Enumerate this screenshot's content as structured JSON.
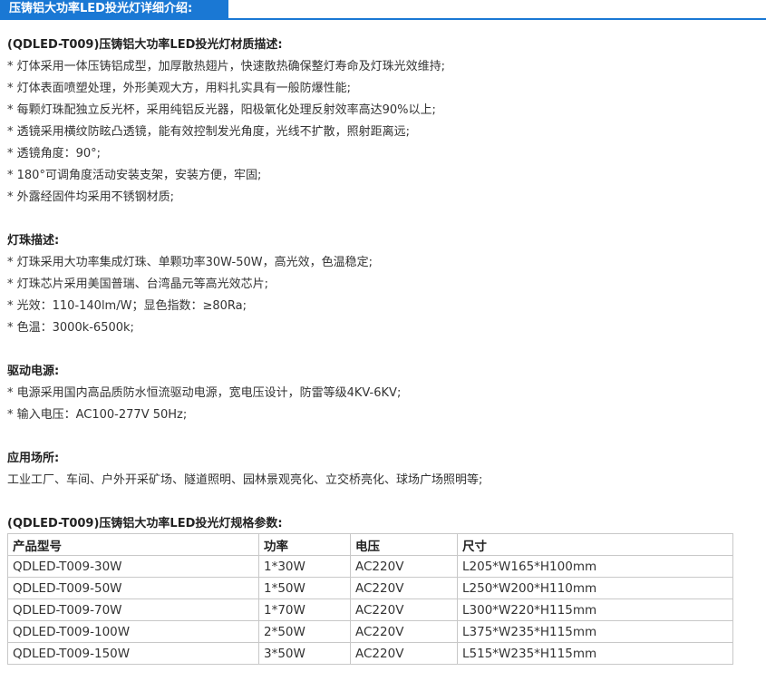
{
  "tab": {
    "title": "压铸铝大功率LED投光灯详细介绍:"
  },
  "sections": {
    "material": {
      "heading": "(QDLED-T009)压铸铝大功率LED投光灯材质描述:",
      "items": [
        "* 灯体采用一体压铸铝成型，加厚散热翅片，快速散热确保整灯寿命及灯珠光效维持;",
        "* 灯体表面喷塑处理，外形美观大方，用料扎实具有一般防爆性能;",
        "* 每颗灯珠配独立反光杯，采用纯铝反光器，阳极氧化处理反射效率高达90%以上;",
        "* 透镜采用横纹防眩凸透镜，能有效控制发光角度，光线不扩散，照射距离远;",
        "* 透镜角度：90°;",
        "* 180°可调角度活动安装支架，安装方便，牢固;",
        "* 外露经固件均采用不锈钢材质;"
      ]
    },
    "led": {
      "heading": "灯珠描述:",
      "items": [
        "* 灯珠采用大功率集成灯珠、单颗功率30W-50W，高光效，色温稳定;",
        "* 灯珠芯片采用美国普瑞、台湾晶元等高光效芯片;",
        "* 光效：110-140lm/W；显色指数：≥80Ra;",
        "* 色温：3000k-6500k;"
      ]
    },
    "driver": {
      "heading": "驱动电源:",
      "items": [
        "* 电源采用国内高品质防水恒流驱动电源，宽电压设计，防雷等级4KV-6KV;",
        "* 输入电压：AC100-277V 50Hz;"
      ]
    },
    "application": {
      "heading": "应用场所:",
      "items": [
        "工业工厂、车间、户外开采矿场、隧道照明、园林景观亮化、立交桥亮化、球场广场照明等;"
      ]
    },
    "spec": {
      "heading": "(QDLED-T009)压铸铝大功率LED投光灯规格参数:"
    }
  },
  "table": {
    "headers": [
      "产品型号",
      "功率",
      "电压",
      "尺寸"
    ],
    "rows": [
      [
        "QDLED-T009-30W",
        "1*30W",
        "AC220V",
        "L205*W165*H100mm"
      ],
      [
        "QDLED-T009-50W",
        "1*50W",
        "AC220V",
        "L250*W200*H110mm"
      ],
      [
        "QDLED-T009-70W",
        "1*70W",
        "AC220V",
        "L300*W220*H115mm"
      ],
      [
        "QDLED-T009-100W",
        "2*50W",
        "AC220V",
        "L375*W235*H115mm"
      ],
      [
        "QDLED-T009-150W",
        "3*50W",
        "AC220V",
        "L515*W235*H115mm"
      ]
    ]
  },
  "colors": {
    "accent": "#1a78d4",
    "text": "#333333",
    "border": "#c8c8c8"
  }
}
